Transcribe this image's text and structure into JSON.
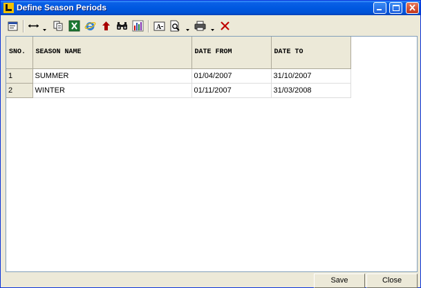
{
  "window": {
    "title": "Define Season Periods"
  },
  "toolbar": {
    "icons": [
      "form-icon",
      "column-width-icon",
      "copy-icon",
      "excel-icon",
      "internet-explorer-icon",
      "arrow-up-icon",
      "find-icon",
      "chart-icon",
      "font-icon",
      "print-preview-icon",
      "printer-icon",
      "delete-icon"
    ]
  },
  "grid": {
    "columns": [
      "SNO.",
      "SEASON NAME",
      "DATE FROM",
      "DATE TO"
    ],
    "rows": [
      {
        "sno": "1",
        "name": "SUMMER",
        "from": "01/04/2007",
        "to": "31/10/2007"
      },
      {
        "sno": "2",
        "name": "WINTER",
        "from": "01/11/2007",
        "to": "31/03/2008"
      }
    ]
  },
  "buttons": {
    "save": "Save",
    "close": "Close"
  },
  "colors": {
    "titlebar": "#0058e0",
    "close_button": "#c2351b",
    "face": "#ece9d8"
  }
}
